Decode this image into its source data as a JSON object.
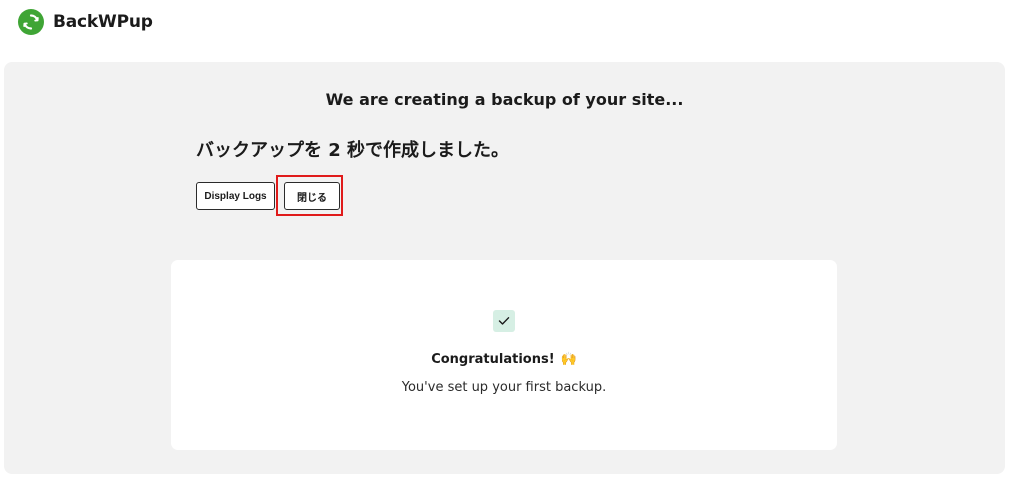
{
  "app": {
    "brand_name": "BackWPup",
    "brand_color": "#3fa535"
  },
  "panel": {
    "heading": "We are creating a backup of your site...",
    "status": "バックアップを 2 秒で作成しました。"
  },
  "buttons": {
    "display_logs_label": "Display Logs",
    "close_label": "閉じる"
  },
  "highlight": {
    "color": "#e01b1b",
    "target": "close-button"
  },
  "success_card": {
    "icon": "check-icon",
    "title": "Congratulations!",
    "emoji": "🙌",
    "message": "You've set up your first backup."
  }
}
